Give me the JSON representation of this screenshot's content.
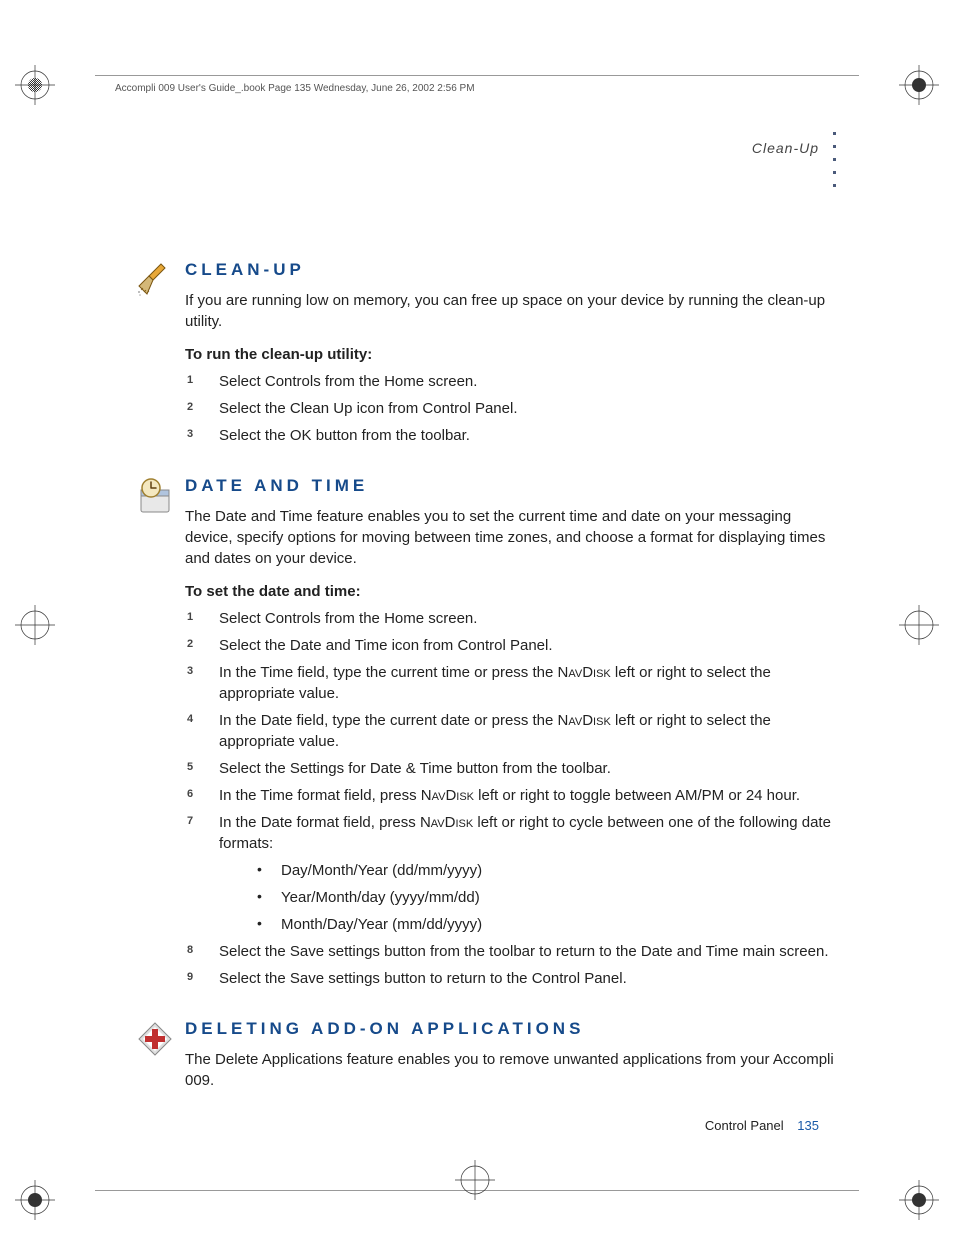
{
  "print_header": "Accompli 009 User's Guide_.book  Page 135  Wednesday, June 26, 2002  2:56 PM",
  "running_head": "Clean-Up",
  "sections": [
    {
      "heading": "CLEAN-UP",
      "intro": "If you are running low on memory, you can free up space on your device by running the clean-up utility.",
      "subhead": "To run the clean-up utility:",
      "steps": [
        {
          "text": "Select Controls from the Home screen."
        },
        {
          "text": "Select the Clean Up icon from Control Panel."
        },
        {
          "text": "Select the OK button from the toolbar."
        }
      ]
    },
    {
      "heading": "DATE AND TIME",
      "intro": "The Date and Time feature enables you to set the current time and date on your messaging device, specify options for moving between time zones, and choose a format for displaying times and dates on your device.",
      "subhead": "To set the date and time:",
      "steps": [
        {
          "text": "Select Controls from the Home screen."
        },
        {
          "text": "Select the Date and Time icon from Control Panel."
        },
        {
          "html": "In the Time field, type the current time or press the <span class=\"navdisk\">NavDisk</span> left or right to select the appropriate value."
        },
        {
          "html": "In the Date field, type the current date or press the <span class=\"navdisk\">NavDisk</span> left or right to select the appropriate value."
        },
        {
          "text": "Select the Settings for Date & Time button from the toolbar."
        },
        {
          "html": "In the Time format field, press <span class=\"navdisk\">NavDisk</span> left or right to toggle between AM/PM or 24 hour."
        },
        {
          "html": "In the Date format field, press <span class=\"navdisk\">NavDisk</span> left or right to cycle between one of the following date formats:",
          "bullets": [
            "Day/Month/Year (dd/mm/yyyy)",
            "Year/Month/day (yyyy/mm/dd)",
            "Month/Day/Year (mm/dd/yyyy)"
          ]
        },
        {
          "text": "Select the Save settings button from the toolbar to return to the Date and Time main screen."
        },
        {
          "text": "Select the Save settings button to return to the Control Panel."
        }
      ]
    },
    {
      "heading": "DELETING ADD-ON APPLICATIONS",
      "intro": "The Delete Applications feature enables you to remove unwanted applications from your Accompli 009."
    }
  ],
  "footer": {
    "label": "Control Panel",
    "page": "135"
  }
}
